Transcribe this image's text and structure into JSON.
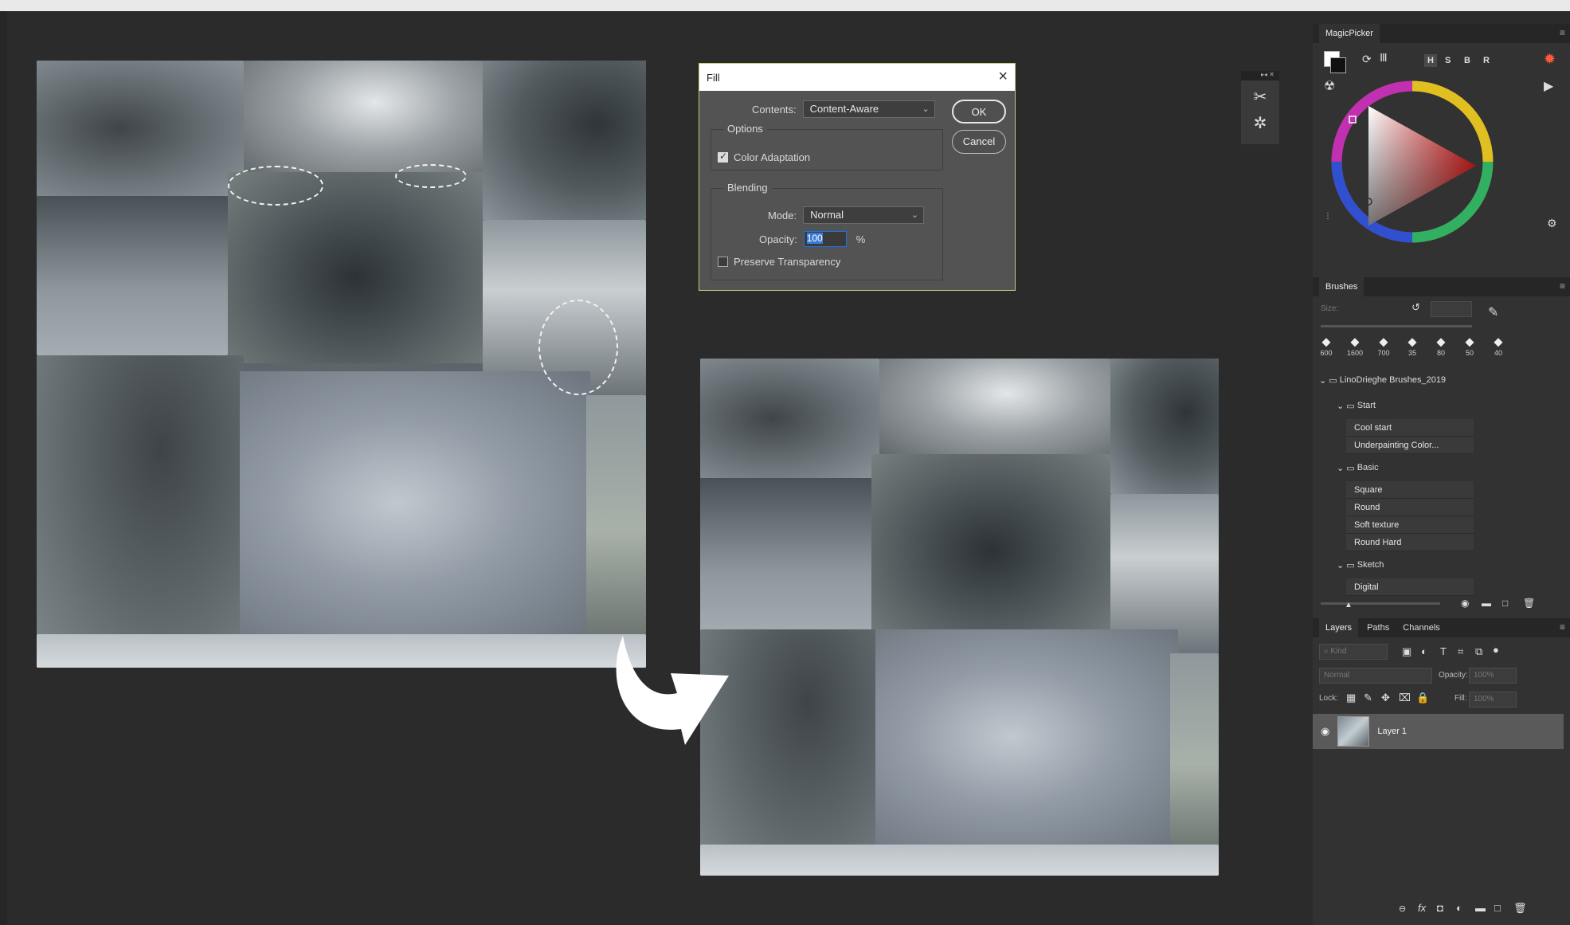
{
  "fill_dialog": {
    "title": "Fill",
    "contents_label": "Contents:",
    "contents_value": "Content-Aware",
    "ok_label": "OK",
    "cancel_label": "Cancel",
    "options_legend": "Options",
    "color_adaptation_label": "Color Adaptation",
    "color_adaptation_checked": true,
    "blending_legend": "Blending",
    "mode_label": "Mode:",
    "mode_value": "Normal",
    "opacity_label": "Opacity:",
    "opacity_value": "100",
    "opacity_unit": "%",
    "preserve_label": "Preserve Transparency",
    "preserve_checked": false
  },
  "magicpicker": {
    "tab_label": "MagicPicker",
    "modes": [
      "H",
      "S",
      "B",
      "R"
    ]
  },
  "brushes": {
    "tab_label": "Brushes",
    "size_label": "Size:",
    "tip_sizes": [
      "600",
      "1600",
      "700",
      "35",
      "80",
      "50",
      "40"
    ],
    "library": "LinoDrieghe Brushes_2019",
    "groups": [
      {
        "name": "Start",
        "items": [
          "Cool start",
          "Underpainting Color..."
        ]
      },
      {
        "name": "Basic",
        "items": [
          "Square",
          "Round",
          "Soft texture",
          "Round Hard"
        ]
      },
      {
        "name": "Sketch",
        "items": [
          "Digital"
        ]
      }
    ]
  },
  "layers": {
    "tabs": [
      "Layers",
      "Paths",
      "Channels"
    ],
    "kind_label": "Kind",
    "blend_mode": "Normal",
    "opacity_label": "Opacity:",
    "opacity_value": "100%",
    "lock_label": "Lock:",
    "fill_label": "Fill:",
    "fill_value": "100%",
    "layer_name": "Layer 1"
  },
  "colors": {
    "background": "#2b2b2b",
    "panel": "#323232",
    "dialog": "#535353",
    "dialog_border": "#c8c77a",
    "selection": "#3b7bd6"
  }
}
